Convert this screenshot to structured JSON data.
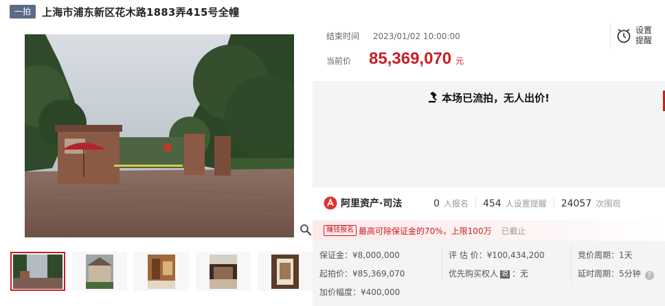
{
  "header": {
    "round_badge": "一拍",
    "title": "上海市浦东新区花木路1883弄415号全幢"
  },
  "gallery": {
    "zoom_icon": "magnifier-icon",
    "thumbnails": [
      "gate",
      "villa-exterior",
      "interior-hall",
      "interior-room",
      "staircase"
    ],
    "active_index": 0
  },
  "auction": {
    "end_label": "结束时间",
    "end_value": "2023/01/02 10:00:00",
    "price_label": "当前价",
    "price_value": "85,369,070",
    "price_unit": "元",
    "remind_label": "设置提醒",
    "remind_icon": "alarm-clock-icon",
    "status_text": "本场已流拍，无人出价!",
    "status_icon": "gavel-icon"
  },
  "stats": {
    "brand": "阿里资产·司法",
    "registrations": "0",
    "registrations_label": "人报名",
    "reminders": "454",
    "reminders_label": "人设置提醒",
    "views": "24057",
    "views_label": "次围观"
  },
  "promo": {
    "tag": "赚钱报名",
    "text": "最高可除保证金的70%，上限100万",
    "deadline": "已截止"
  },
  "info": {
    "deposit_label": "保证金：",
    "deposit_value": "¥8,000,000",
    "appraisal_label": "评 估 价：",
    "appraisal_value": "¥100,434,200",
    "cycle_label": "竞价周期：",
    "cycle_value": "1天",
    "start_price_label": "起拍价：",
    "start_price_value": "¥85,369,070",
    "priority_label": "优先购买权人",
    "priority_badge": "说",
    "priority_value": "：无",
    "delay_label": "延时周期：",
    "delay_value": "5分钟",
    "increment_label": "加价幅度：",
    "increment_value": "¥400,000"
  },
  "colors": {
    "accent": "#c81e24",
    "badge": "#5c6b8a",
    "panel": "#f4f4f4"
  }
}
